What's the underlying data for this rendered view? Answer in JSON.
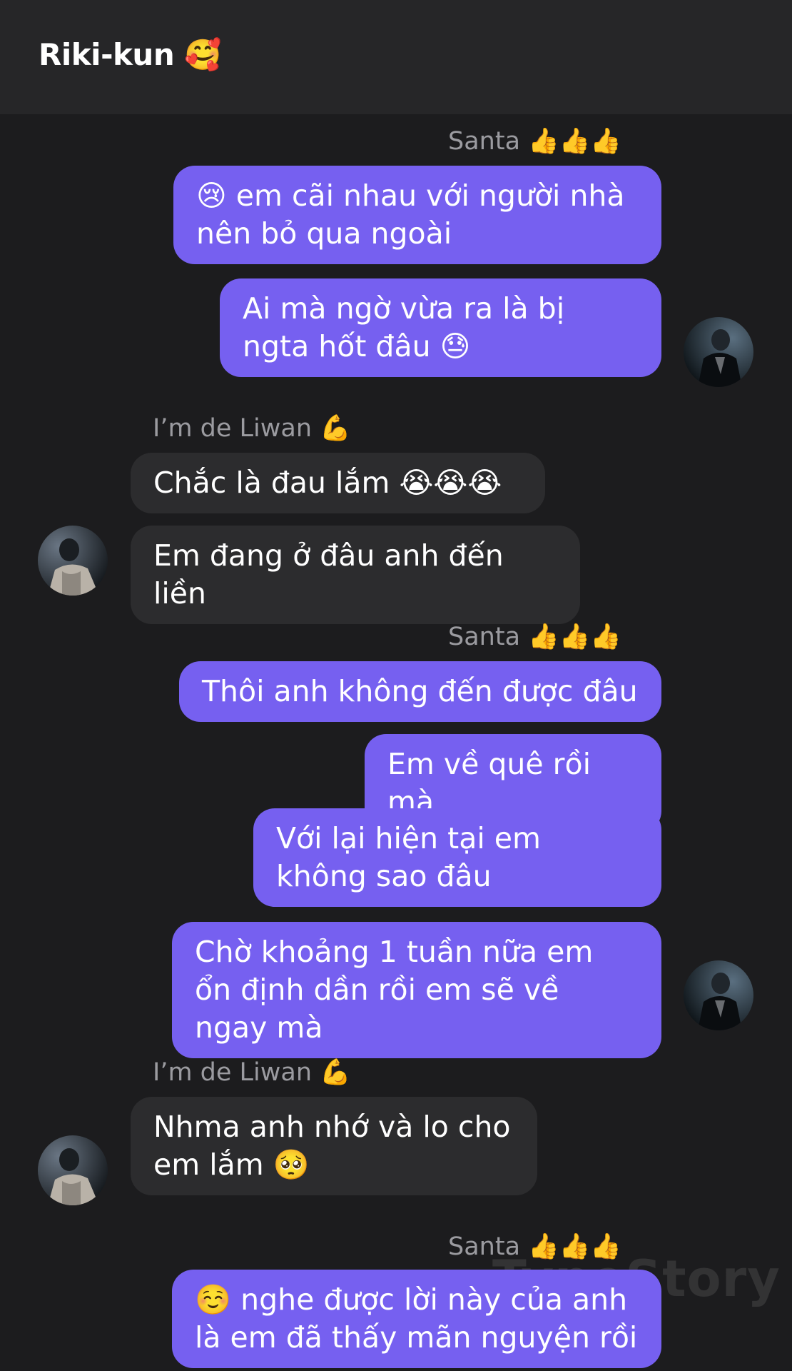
{
  "header": {
    "title": "Riki-kun 🥰"
  },
  "names": {
    "santa": "Santa 👍👍👍",
    "liwan": "I’m de Liwan 💪"
  },
  "messages": [
    "😢 em cãi nhau với người nhà nên bỏ qua ngoài",
    "Ai mà ngờ vừa ra là bị ngta hốt đâu 😓",
    "Chắc là đau lắm 😭😭😭",
    "Em đang ở đâu anh đến liền",
    "Thôi anh không đến được đâu",
    "Em về quê rồi mà",
    "Với lại hiện tại em không sao đâu",
    "Chờ khoảng 1 tuần nữa em ổn định dần rồi em sẽ về ngay mà",
    "Nhma anh nhớ và lo cho em lắm 🥺",
    "☺️ nghe được lời này của anh là em đã thấy mãn nguyện rồi"
  ],
  "watermark": "TypeStory",
  "colors": {
    "background": "#1c1c1e",
    "header": "#262628",
    "outgoing_bubble": "#7660f0",
    "incoming_bubble": "#2c2c2e",
    "name_label": "#9b9ba0"
  }
}
